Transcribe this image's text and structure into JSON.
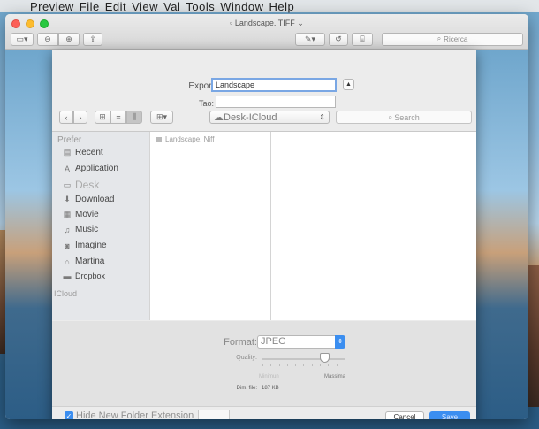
{
  "menubar": {
    "items": [
      "Preview",
      "File",
      "Edit",
      "View",
      "Val",
      "Tools",
      "Window",
      "Help"
    ]
  },
  "window": {
    "title": "Landscape. TIFF"
  },
  "toolbar": {
    "search_placeholder": "Ricerca"
  },
  "export": {
    "export_as_label": "Export As:",
    "export_as_value": "Landscape",
    "tag_label": "Tao:",
    "location": "Desk-ICloud",
    "search_placeholder": "Search"
  },
  "sidebar": {
    "favorites_header": "Prefer",
    "items": [
      {
        "label": "Recent",
        "icon": "clock-icon"
      },
      {
        "label": "Application",
        "icon": "apps-icon"
      },
      {
        "label": "Desk",
        "icon": "desktop-icon"
      },
      {
        "label": "Download",
        "icon": "download-icon"
      },
      {
        "label": "Movie",
        "icon": "movie-icon"
      },
      {
        "label": "Music",
        "icon": "music-icon"
      },
      {
        "label": "Imagine",
        "icon": "camera-icon"
      },
      {
        "label": "Martina",
        "icon": "home-icon"
      },
      {
        "label": "Dropbox",
        "icon": "folder-icon"
      }
    ],
    "icloud_header": "ICloud"
  },
  "files": [
    {
      "name": "Landscape. Niff"
    }
  ],
  "format": {
    "label": "Format:",
    "value": "JPEG",
    "quality_label": "Quality:",
    "quality_level": 0.75,
    "min_label": "Minimun",
    "max_label": "Massima",
    "size_label": "Dim. file:",
    "size_value": "187 KB"
  },
  "footer": {
    "hide_extension_label": "Hide New Folder Extension",
    "hide_extension_checked": true,
    "cancel_label": "Cancel",
    "save_label": "Save"
  }
}
